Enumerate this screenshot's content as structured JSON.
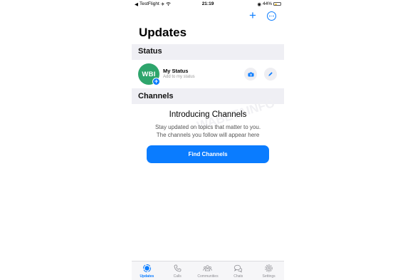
{
  "status_bar": {
    "carrier": "TestFlight",
    "time": "21:19",
    "battery_percent": "44%",
    "battery_level": 0.44
  },
  "header": {
    "title": "Updates",
    "add_icon": "plus-icon",
    "more_icon": "ellipsis-circle-icon"
  },
  "status_section": {
    "label": "Status",
    "my_status": {
      "avatar_text": "WBI",
      "name": "My Status",
      "subtitle": "Add to my status"
    }
  },
  "channels_section": {
    "label": "Channels",
    "title": "Introducing Channels",
    "description_line1": "Stay updated on topics that matter to you.",
    "description_line2": "The channels you follow will appear here",
    "button_label": "Find Channels"
  },
  "tab_bar": {
    "tabs": [
      {
        "label": "Updates",
        "icon": "updates-icon",
        "active": true
      },
      {
        "label": "Calls",
        "icon": "phone-icon",
        "active": false
      },
      {
        "label": "Communities",
        "icon": "people-icon",
        "active": false
      },
      {
        "label": "Chats",
        "icon": "chat-bubbles-icon",
        "active": false
      },
      {
        "label": "Settings",
        "icon": "gear-icon",
        "active": false
      }
    ]
  },
  "colors": {
    "accent": "#0a7cff",
    "avatar_bg": "#2ea56c",
    "background": "#efeff4",
    "battery": "#f2c94c"
  }
}
